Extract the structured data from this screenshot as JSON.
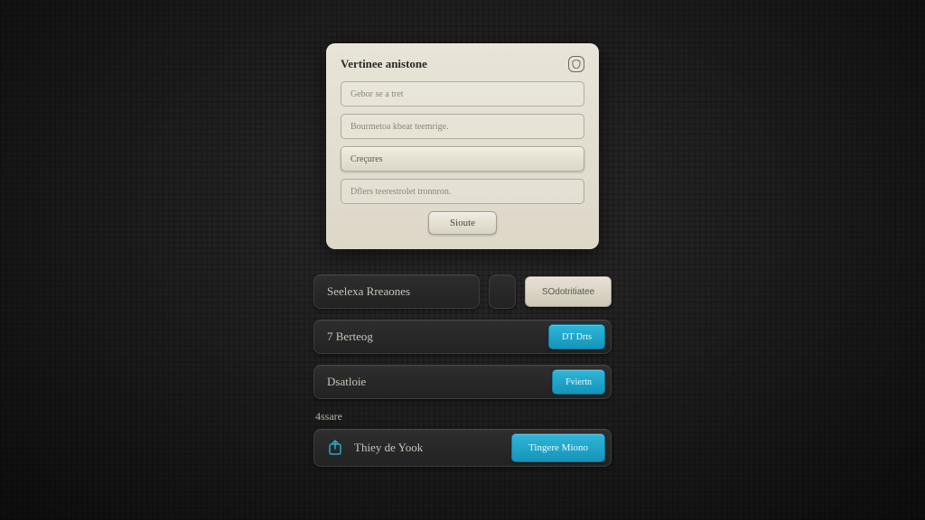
{
  "card": {
    "title": "Vertinee anistone",
    "field1_placeholder": "Gebor se a tret",
    "field2_placeholder": "Bourmetoa kbeat teemrige.",
    "field3_placeholder": "Creçures",
    "field4_placeholder": "Dflers teerestrolet tronnron.",
    "submit_label": "Sioute"
  },
  "rows": {
    "r1_label": "Seelexa Rreaones",
    "r1_button": "SOdotritiatee",
    "r2_label": "7 Berteog",
    "r2_button": "DT Drts",
    "r3_label": "Dsatloie",
    "r3_button": "Fviertn",
    "section_label": "4ssare",
    "r4_label": "Thiey de Yook",
    "r4_button": "Tingere Miono"
  },
  "colors": {
    "accent": "#1ea7cb",
    "card_bg": "#e3dece",
    "dark_pill": "#272727"
  }
}
